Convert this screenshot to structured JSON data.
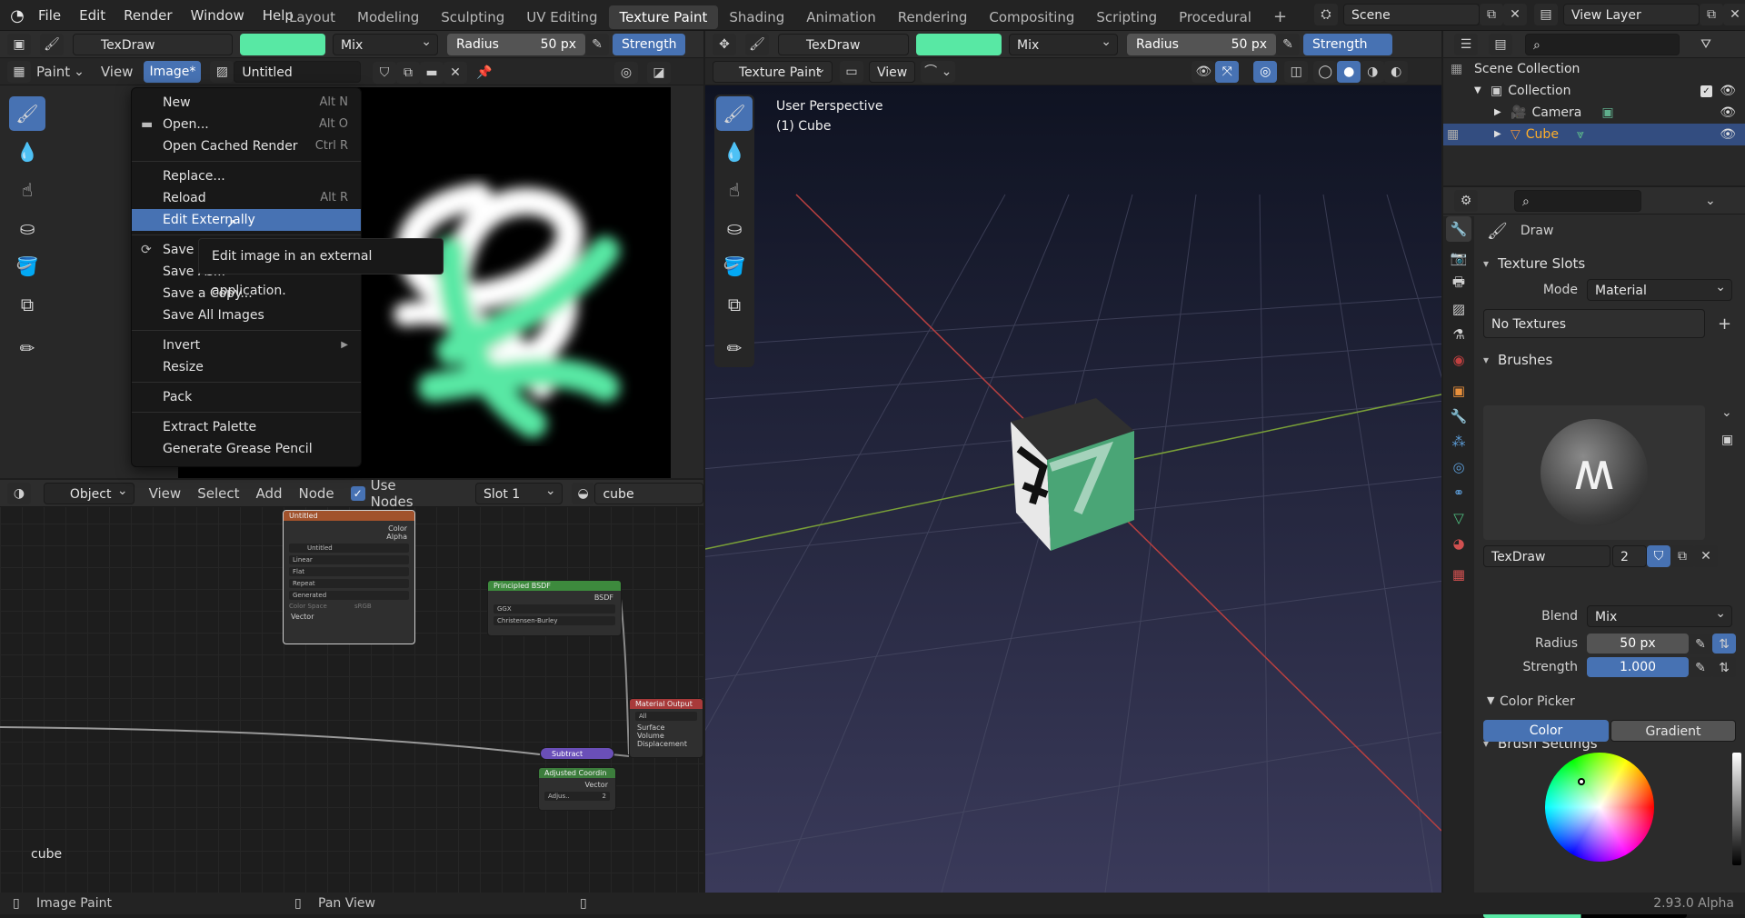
{
  "topbar": {
    "menus": [
      "File",
      "Edit",
      "Render",
      "Window",
      "Help"
    ],
    "workspaces": [
      "Layout",
      "Modeling",
      "Sculpting",
      "UV Editing",
      "Texture Paint",
      "Shading",
      "Animation",
      "Rendering",
      "Compositing",
      "Scripting",
      "Procedural"
    ],
    "active_workspace": "Texture Paint",
    "scene": "Scene",
    "view_layer": "View Layer"
  },
  "image_editor": {
    "brush_name": "TexDraw",
    "blend": "Mix",
    "radius_label": "Radius",
    "radius_value": "50 px",
    "strength_label": "Strength",
    "mode": "Paint",
    "view_menu": "View",
    "image_menu": "Image*",
    "image_name": "Untitled"
  },
  "image_menu": {
    "items": [
      {
        "label": "New",
        "shortcut": "Alt N"
      },
      {
        "label": "Open...",
        "shortcut": "Alt O"
      },
      {
        "label": "Open Cached Render",
        "shortcut": "Ctrl R"
      },
      {
        "label": "Replace...",
        "shortcut": ""
      },
      {
        "label": "Reload",
        "shortcut": "Alt R"
      },
      {
        "label": "Edit Externally",
        "shortcut": ""
      },
      {
        "label": "Save",
        "shortcut": ""
      },
      {
        "label": "Save As...",
        "shortcut": ""
      },
      {
        "label": "Save a Copy...",
        "shortcut": ""
      },
      {
        "label": "Save All Images",
        "shortcut": ""
      },
      {
        "label": "Invert",
        "shortcut": ""
      },
      {
        "label": "Resize",
        "shortcut": ""
      },
      {
        "label": "Pack",
        "shortcut": ""
      },
      {
        "label": "Extract Palette",
        "shortcut": ""
      },
      {
        "label": "Generate Grease Pencil",
        "shortcut": ""
      }
    ],
    "highlighted": "Edit Externally",
    "tooltip": "Edit image in an external application."
  },
  "viewport": {
    "brush_name": "TexDraw",
    "blend": "Mix",
    "radius_label": "Radius",
    "radius_value": "50 px",
    "strength_label": "Strength",
    "mode": "Texture Paint",
    "view_menu": "View",
    "perspective": "User Perspective",
    "object": "(1) Cube"
  },
  "node_editor": {
    "object_mode": "Object",
    "menus": [
      "View",
      "Select",
      "Add",
      "Node"
    ],
    "use_nodes_label": "Use Nodes",
    "slot": "Slot 1",
    "material": "cube",
    "footer_label": "cube",
    "nodes": {
      "image_texture": {
        "title": "Untitled",
        "out1": "Color",
        "out2": "Alpha",
        "image": "Untitled",
        "interp": "Linear",
        "proj": "Flat",
        "ext": "Repeat",
        "source": "Generated",
        "colorspace_label": "Color Space",
        "colorspace": "sRGB",
        "vector": "Vector"
      },
      "bsdf": {
        "title": "Principled BSDF",
        "out": "BSDF",
        "dist": "GGX",
        "sss": "Christensen-Burley"
      },
      "output": {
        "title": "Material Output",
        "target": "All",
        "in1": "Surface",
        "in2": "Volume",
        "in3": "Displacement"
      },
      "subtract": {
        "title": "Subtract"
      },
      "coord": {
        "title": "Adjusted Coordin",
        "out": "Vector",
        "field": "Adjus..",
        "count": "2"
      }
    }
  },
  "outliner": {
    "root": "Scene Collection",
    "collection": "Collection",
    "items": [
      "Camera",
      "Cube"
    ],
    "selected": "Cube"
  },
  "properties": {
    "tool_name": "Draw",
    "texture_slots": {
      "title": "Texture Slots",
      "mode_label": "Mode",
      "mode": "Material",
      "empty": "No Textures"
    },
    "brushes": {
      "title": "Brushes",
      "name": "TexDraw",
      "users": "2"
    },
    "brush_settings": {
      "title": "Brush Settings",
      "blend_label": "Blend",
      "blend": "Mix",
      "radius_label": "Radius",
      "radius": "50 px",
      "strength_label": "Strength",
      "strength": "1.000"
    },
    "color_picker": {
      "title": "Color Picker",
      "tab_color": "Color",
      "tab_gradient": "Gradient",
      "color": "#58e8a4"
    }
  },
  "statusbar": {
    "left": "Image Paint",
    "middle": "Pan View",
    "version": "2.93.0 Alpha"
  },
  "colors": {
    "accent": "#4772b3",
    "paint": "#58e8a4",
    "active_object": "#f0a030"
  }
}
